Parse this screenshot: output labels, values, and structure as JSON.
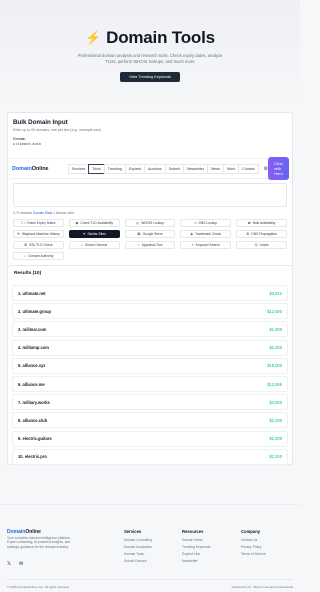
{
  "hero": {
    "title": "Domain Tools",
    "subtitle": "Professional domain analysis and research tools. Check expiry dates, analyze TLDs, perform WHOIS lookups, and much more",
    "cta": "View Trending Keywords"
  },
  "bulk": {
    "title": "Bulk Domain Input",
    "subtitle": "Enter up to 50 domains, one per line (e.g., example.com)",
    "label": "Domain",
    "value": "ultimate.auto"
  },
  "nav": {
    "brand_a": "Domain",
    "brand_b": "Online",
    "items": [
      "Services",
      "Tools",
      "Trending",
      "Expired",
      "Auctions",
      "Submit",
      "Newsletter",
      "News",
      "Work",
      "Contact"
    ],
    "chat": "Chat with Hero"
  },
  "meta": {
    "left": "0 / 5 domains",
    "link": "Domain Stats",
    "right": "1 domain valid"
  },
  "tools": [
    {
      "icon": "☐",
      "label": "Check Expiry Dates"
    },
    {
      "icon": "◉",
      "label": "Check TLD Availability"
    },
    {
      "icon": "◎",
      "label": "WHOIS Lookup"
    },
    {
      "icon": "≡",
      "label": "DNS Lookup"
    },
    {
      "icon": "⇄",
      "label": "Bulk Availability"
    },
    {
      "icon": "⟲",
      "label": "Wayback Machine History"
    },
    {
      "icon": "✦",
      "label": "Similar Sites"
    },
    {
      "icon": "▤",
      "label": "Google Serve"
    },
    {
      "icon": "◈",
      "label": "Trademark Check"
    },
    {
      "icon": "⚙",
      "label": "DNS Propagation"
    },
    {
      "icon": "⊞",
      "label": "SSL/TLS Check"
    },
    {
      "icon": "⌕",
      "label": "Search Volume"
    },
    {
      "icon": "⌁",
      "label": "Appraisal Tool"
    },
    {
      "icon": "⌖",
      "label": "Keyword Search"
    },
    {
      "icon": "⌬",
      "label": "Leads"
    },
    {
      "icon": "☆",
      "label": "Domain Authority"
    }
  ],
  "results": {
    "title": "Results (10)",
    "rows": [
      {
        "domain": "1. ultimate.net",
        "price": "$3,822"
      },
      {
        "domain": "2. ultimate.group",
        "price": "$12,580"
      },
      {
        "domain": "3. militear.com",
        "price": "$1,000"
      },
      {
        "domain": "4. militamp.com",
        "price": "$2,200"
      },
      {
        "domain": "5. alliance.xyz",
        "price": "$18,000"
      },
      {
        "domain": "6. alliance.me",
        "price": "$13,089"
      },
      {
        "domain": "7. military.works",
        "price": "$4,500"
      },
      {
        "domain": "8. alliance.club",
        "price": "$2,200"
      },
      {
        "domain": "9. electric.guitars",
        "price": "$2,200"
      },
      {
        "domain": "10. electric.pro",
        "price": "$2,200"
      }
    ]
  },
  "footer": {
    "brand_a": "Domain",
    "brand_b": "Online",
    "desc": "Your complete domain intelligence platform. Expert consulting, AI-powered insights, and strategic guidance for the domain industry.",
    "col1": {
      "title": "Services",
      "items": [
        "Domain Consulting",
        "Domain Acquisition",
        "Domain Tools",
        "Submit Domain"
      ]
    },
    "col2": {
      "title": "Resources",
      "items": [
        "Domain News",
        "Trending Keywords",
        "Expired Hub",
        "Newsletter"
      ]
    },
    "col3": {
      "title": "Company",
      "items": [
        "Contact Us",
        "Privacy Policy",
        "Terms of Service"
      ]
    },
    "copy": "© 2025 DomainOnline.com. All rights reserved.",
    "powered": "Powered by AI · Built for domain professionals"
  }
}
